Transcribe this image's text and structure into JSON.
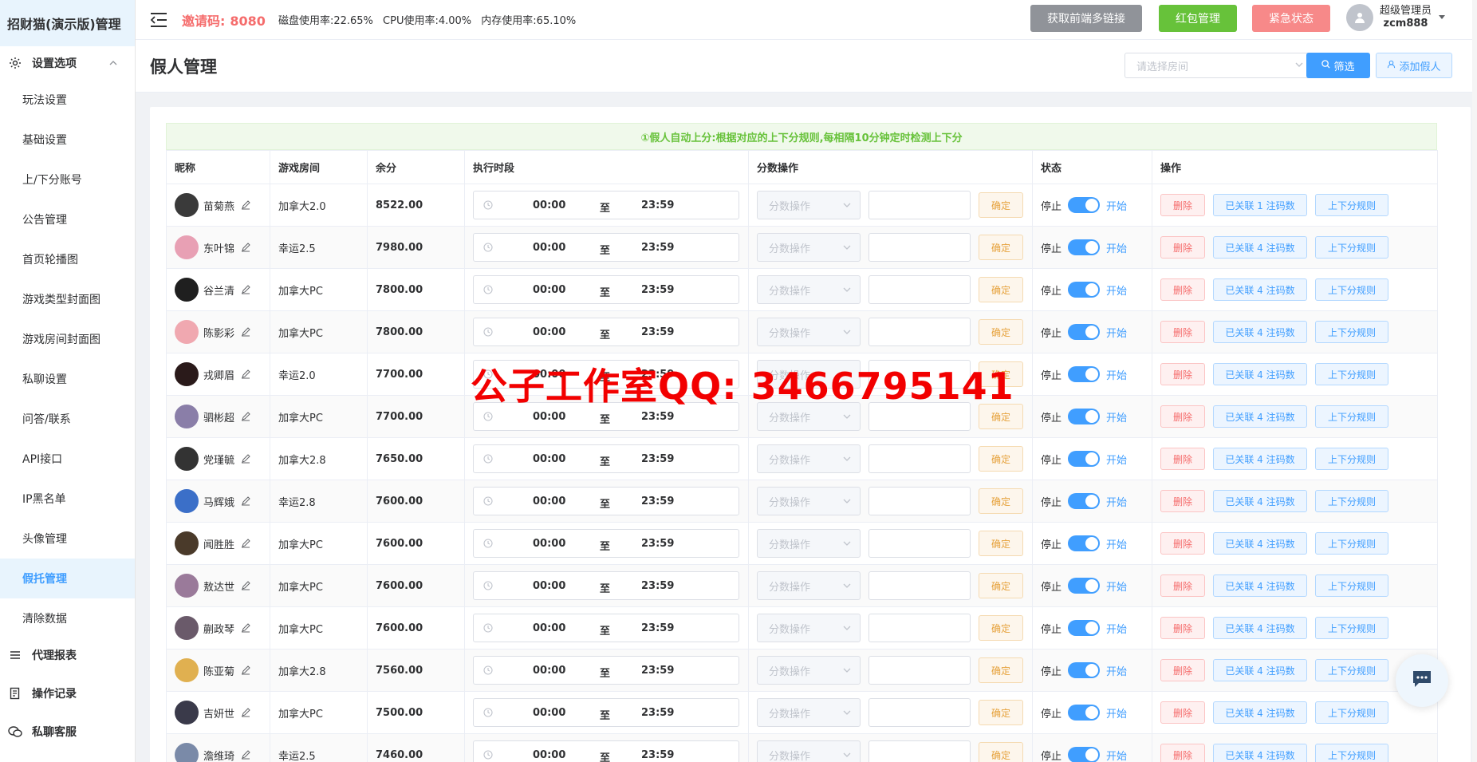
{
  "app": {
    "title": "招财猫(演示版)管理"
  },
  "sidebar": {
    "group_settings": "设置选项",
    "items": [
      {
        "label": "玩法设置",
        "active": false
      },
      {
        "label": "基础设置",
        "active": false
      },
      {
        "label": "上/下分账号",
        "active": false
      },
      {
        "label": "公告管理",
        "active": false
      },
      {
        "label": "首页轮播图",
        "active": false
      },
      {
        "label": "游戏类型封面图",
        "active": false
      },
      {
        "label": "游戏房间封面图",
        "active": false
      },
      {
        "label": "私聊设置",
        "active": false
      },
      {
        "label": "问答/联系",
        "active": false
      },
      {
        "label": "API接口",
        "active": false
      },
      {
        "label": "IP黑名单",
        "active": false
      },
      {
        "label": "头像管理",
        "active": false
      },
      {
        "label": "假托管理",
        "active": true
      },
      {
        "label": "清除数据",
        "active": false
      }
    ],
    "group_agent": "代理报表",
    "group_logs": "操作记录",
    "group_chat": "私聊客服"
  },
  "header": {
    "invite_label": "邀请码:",
    "invite_code": "8080",
    "disk": "磁盘使用率:22.65%",
    "cpu": "CPU使用率:4.00%",
    "mem": "内存使用率:65.10%",
    "btn_links": "获取前端多链接",
    "btn_redpacket": "红包管理",
    "btn_emergency": "紧急状态",
    "user_role": "超级管理员",
    "user_name": "zcm888"
  },
  "page": {
    "title": "假人管理",
    "room_placeholder": "请选择房间",
    "btn_filter": "筛选",
    "btn_add": "添加假人"
  },
  "table": {
    "notice": "①假人自动上分:根据对应的上下分规则,每相隔10分钟定时检测上下分",
    "headers": {
      "nick": "昵称",
      "room": "游戏房间",
      "balance": "余分",
      "period": "执行时段",
      "score_op": "分数操作",
      "status": "状态",
      "ops": "操作"
    },
    "time_sep": "至",
    "op_placeholder": "分数操作",
    "confirm": "确定",
    "stop": "停止",
    "start": "开始",
    "delete": "删除",
    "rule": "上下分规则",
    "rows": [
      {
        "nick": "苗菊燕",
        "room": "加拿大2.0",
        "balance": "8522.00",
        "start": "00:00",
        "end": "23:59",
        "linked": "已关联 1 注码数",
        "avatar_color": "#3a3a3a"
      },
      {
        "nick": "东叶锦",
        "room": "幸运2.5",
        "balance": "7980.00",
        "start": "00:00",
        "end": "23:59",
        "linked": "已关联 4 注码数",
        "avatar_color": "#e8a0b4"
      },
      {
        "nick": "谷兰清",
        "room": "加拿大PC",
        "balance": "7800.00",
        "start": "00:00",
        "end": "23:59",
        "linked": "已关联 4 注码数",
        "avatar_color": "#1f1f1f"
      },
      {
        "nick": "陈影彩",
        "room": "加拿大PC",
        "balance": "7800.00",
        "start": "00:00",
        "end": "23:59",
        "linked": "已关联 4 注码数",
        "avatar_color": "#f0a8b0"
      },
      {
        "nick": "戎卿眉",
        "room": "幸运2.0",
        "balance": "7700.00",
        "start": "00:00",
        "end": "23:59",
        "linked": "已关联 4 注码数",
        "avatar_color": "#2a1a1a"
      },
      {
        "nick": "驷彬超",
        "room": "加拿大PC",
        "balance": "7700.00",
        "start": "00:00",
        "end": "23:59",
        "linked": "已关联 4 注码数",
        "avatar_color": "#8a7ea8"
      },
      {
        "nick": "党瑾毓",
        "room": "加拿大2.8",
        "balance": "7650.00",
        "start": "00:00",
        "end": "23:59",
        "linked": "已关联 4 注码数",
        "avatar_color": "#333333"
      },
      {
        "nick": "马辉娥",
        "room": "幸运2.8",
        "balance": "7600.00",
        "start": "00:00",
        "end": "23:59",
        "linked": "已关联 4 注码数",
        "avatar_color": "#3b6fc8"
      },
      {
        "nick": "闻胜胜",
        "room": "加拿大PC",
        "balance": "7600.00",
        "start": "00:00",
        "end": "23:59",
        "linked": "已关联 4 注码数",
        "avatar_color": "#4a3a2a"
      },
      {
        "nick": "敖达世",
        "room": "加拿大PC",
        "balance": "7600.00",
        "start": "00:00",
        "end": "23:59",
        "linked": "已关联 4 注码数",
        "avatar_color": "#9a7a9a"
      },
      {
        "nick": "蒯政琴",
        "room": "加拿大PC",
        "balance": "7600.00",
        "start": "00:00",
        "end": "23:59",
        "linked": "已关联 4 注码数",
        "avatar_color": "#6a5a6a"
      },
      {
        "nick": "陈亚菊",
        "room": "加拿大2.8",
        "balance": "7560.00",
        "start": "00:00",
        "end": "23:59",
        "linked": "已关联 4 注码数",
        "avatar_color": "#e0b050"
      },
      {
        "nick": "吉妍世",
        "room": "加拿大PC",
        "balance": "7500.00",
        "start": "00:00",
        "end": "23:59",
        "linked": "已关联 4 注码数",
        "avatar_color": "#3a3a4a"
      },
      {
        "nick": "澹维琦",
        "room": "幸运2.5",
        "balance": "7460.00",
        "start": "00:00",
        "end": "23:59",
        "linked": "已关联 4 注码数",
        "avatar_color": "#7a8aa8"
      }
    ]
  },
  "watermark": "公子工作室QQ: 3466795141",
  "colors": {
    "primary": "#409eff",
    "danger": "#f56c6c",
    "success": "#67c23a",
    "warning": "#e6a23c"
  }
}
